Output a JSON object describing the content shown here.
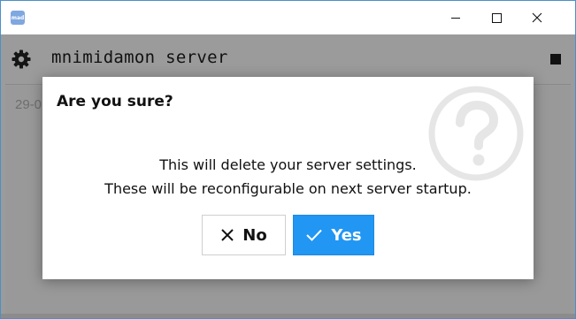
{
  "window": {
    "app_icon_text": "mad",
    "controls": [
      "minimize",
      "maximize",
      "close"
    ]
  },
  "header": {
    "server_name": "mnimidamon server",
    "settings_icon": "gear-icon",
    "stop_icon": "stop-icon"
  },
  "log": {
    "first_line": "29-0"
  },
  "dialog": {
    "title": "Are you sure?",
    "message_line1": "This will delete your server settings.",
    "message_line2": "These will be reconfigurable on next server startup.",
    "no_label": "No",
    "yes_label": "Yes",
    "watermark_icon": "question-circle-icon"
  },
  "colors": {
    "accent": "#2196f3",
    "overlay": "#9b9b9b",
    "window_border": "#4a90c8"
  }
}
